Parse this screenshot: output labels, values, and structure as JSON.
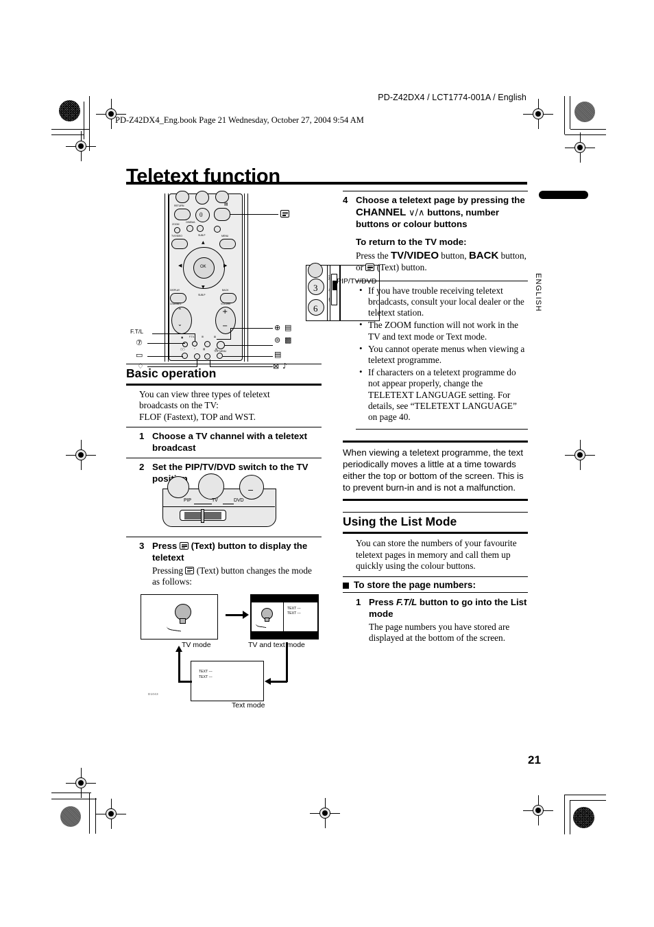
{
  "header": {
    "model_line": "PD-Z42DX4 / LCT1774-001A / English",
    "book_line": "PD-Z42DX4_Eng.book  Page 21  Wednesday, October 27, 2004  9:54 AM"
  },
  "title": "Teletext function",
  "side": {
    "language_tab": "ENGLISH",
    "page_number": "21"
  },
  "remote": {
    "labels": {
      "return": "RETURN",
      "zero": "0",
      "zoom": "ZOOM",
      "cinema": "CINEMA",
      "tvvideo": "TV/VIDEO",
      "sub_p_up": "SUB-P",
      "menu": "MENU",
      "ok": "OK",
      "display": "DISPLAY",
      "back": "BACK",
      "sub_p_down": "SUB-P",
      "channel": "CHANNEL",
      "volume": "VOLUME",
      "ftl": "F.T/L",
      "top_menu": "TOP MENU",
      "three": "3",
      "six": "6"
    },
    "callout": "PIP/TV/\nDVD",
    "left_callouts": [
      "F.T/L"
    ],
    "switch_positions": [
      "PIP",
      "TV",
      "DVD"
    ]
  },
  "left_column": {
    "section_heading": "Basic operation",
    "intro": "You can view three types of teletext broadcasts on the TV:\nFLOF (Fastext), TOP and WST.",
    "steps": [
      {
        "num": "1",
        "heading": "Choose a TV channel with a teletext broadcast"
      },
      {
        "num": "2",
        "heading": "Set the PIP/TV/DVD switch to the TV position"
      },
      {
        "num": "3",
        "heading_a": "Press ",
        "heading_b": " (Text) button to display the teletext",
        "body_a": "Pressing ",
        "body_b": " (Text) button changes the mode as follows:"
      }
    ],
    "flow": {
      "tv_mode": "TV mode",
      "tv_and_text_mode": "TV and text mode",
      "text_mode": "Text mode",
      "screen_text_line1": "TEXT ---",
      "screen_text_line2": "TEXT ---",
      "figure_code": "D1043"
    }
  },
  "right_column": {
    "step4": {
      "num": "4",
      "heading_parts": [
        "Choose a teletext page by pressing the ",
        "CHANNEL",
        " ",
        "∨/∧",
        " buttons, number buttons or colour buttons"
      ],
      "return_heading": "To return to the TV mode:",
      "return_body_1": "Press the ",
      "return_body_bold_1": "TV/VIDEO",
      "return_body_2": " button, ",
      "return_body_bold_2": "BACK",
      "return_body_3": " button, or ",
      "return_body_4": " (Text) button."
    },
    "bullets": [
      "If you have trouble receiving teletext broadcasts, consult your local dealer or the teletext station.",
      "The ZOOM function will not work in the TV and text mode or Text mode.",
      "You cannot operate menus when viewing a teletext programme.",
      "If characters on a teletext programme do not appear properly, change the TELETEXT LANGUAGE setting. For details, see “TELETEXT LANGUAGE” on page 40."
    ],
    "note": "When viewing a teletext programme, the text periodically moves a little at a time towards either the top or bottom of the screen. This is to prevent burn-in and is not a malfunction.",
    "section_heading": "Using the List Mode",
    "section_intro": "You can store the numbers of your favourite teletext pages in memory and call them up quickly using the colour buttons.",
    "subhead": "To store the page numbers:",
    "step1": {
      "num": "1",
      "heading_a": "Press ",
      "heading_b": "F.T/L",
      "heading_c": " button to go into the List mode",
      "body": "The page numbers you have stored are displayed at the bottom of the screen."
    }
  }
}
